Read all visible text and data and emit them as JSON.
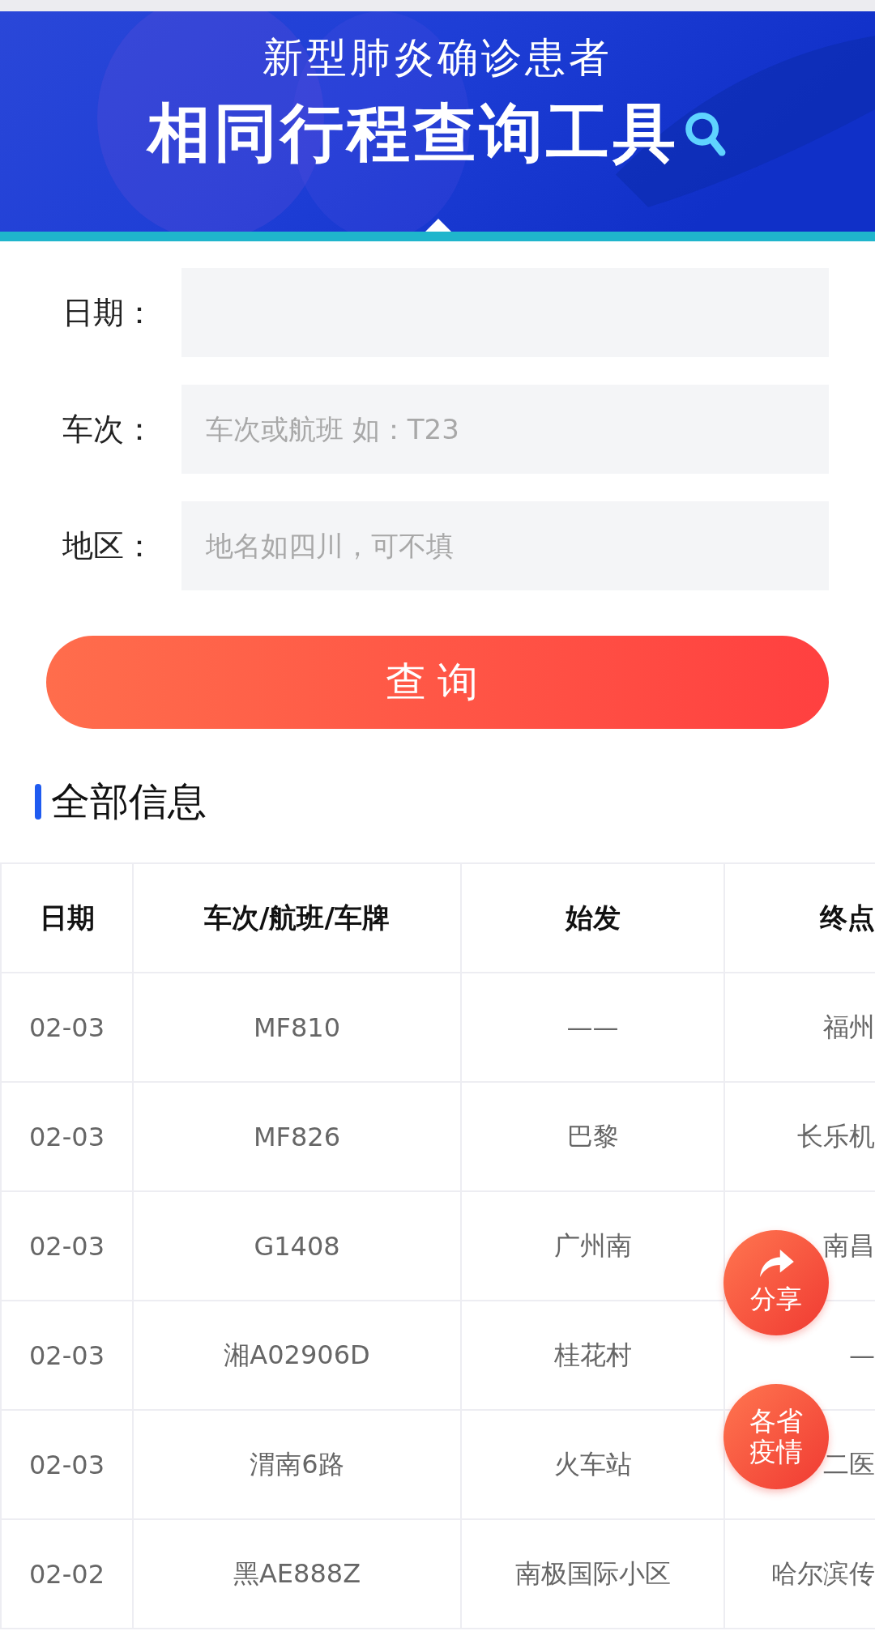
{
  "banner": {
    "subtitle": "新型肺炎确诊患者",
    "title": "相同行程查询工具"
  },
  "form": {
    "fields": [
      {
        "label": "日期："
      },
      {
        "label": "车次：",
        "placeholder": "车次或航班 如：T23"
      },
      {
        "label": "地区：",
        "placeholder": "地名如四川，可不填"
      }
    ],
    "submit": "查询"
  },
  "section_title": "全部信息",
  "table": {
    "columns": [
      "日期",
      "车次/航班/车牌",
      "始发",
      "终点"
    ],
    "rows": [
      [
        "02-03",
        "MF810",
        "——",
        "福州"
      ],
      [
        "02-03",
        "MF826",
        "巴黎",
        "长乐机"
      ],
      [
        "02-03",
        "G1408",
        "广州南",
        "南昌"
      ],
      [
        "02-03",
        "湘A02906D",
        "桂花村",
        "—"
      ],
      [
        "02-03",
        "渭南6路",
        "火车站",
        "二医"
      ],
      [
        "02-02",
        "黑AE888Z",
        "南极国际小区",
        "哈尔滨传"
      ]
    ]
  },
  "floating_buttons": [
    {
      "kind": "share",
      "label": "分享"
    },
    {
      "kind": "text",
      "label": "各省疫情"
    }
  ]
}
